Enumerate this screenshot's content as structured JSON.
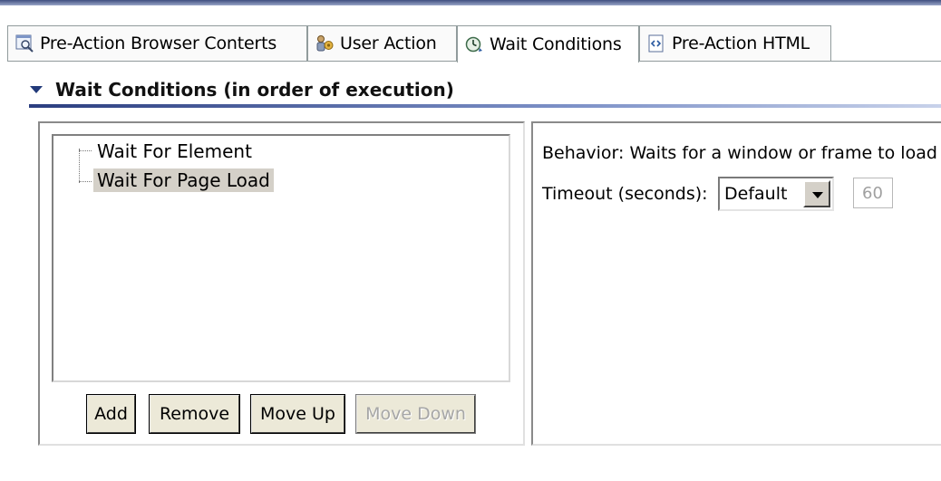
{
  "tabs": [
    {
      "label": "Pre-Action Browser Conterts",
      "icon": "browser-preview-icon",
      "active": false
    },
    {
      "label": "User Action",
      "icon": "user-action-icon",
      "active": false
    },
    {
      "label": "Wait Conditions",
      "icon": "wait-conditions-icon",
      "active": true
    },
    {
      "label": "Pre-Action HTML",
      "icon": "html-icon",
      "active": false
    }
  ],
  "section": {
    "title": "Wait Conditions (in order of execution)"
  },
  "conditions": [
    {
      "label": "Wait For Element",
      "selected": false
    },
    {
      "label": "Wait For Page Load",
      "selected": true
    }
  ],
  "buttons": {
    "add": "Add",
    "remove": "Remove",
    "move_up": "Move Up",
    "move_down": "Move Down"
  },
  "details": {
    "behavior": "Behavior: Waits for a window or frame to load",
    "timeout_label": "Timeout (seconds):",
    "timeout_option": "Default",
    "timeout_value": "60"
  },
  "colors": {
    "accent": "#223a7a",
    "selection": "#d4d0c8",
    "button_face": "#ece9d8"
  }
}
